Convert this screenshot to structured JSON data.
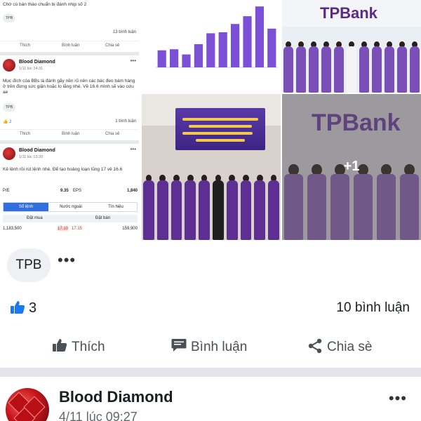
{
  "media": {
    "screenshot": {
      "post_top": {
        "text": "Chờ cú bán tháo chuẩn bị đánh nhịp số 2",
        "tag": "TPB",
        "comments": "13 bình luận",
        "actions": [
          "Thích",
          "Bình luận",
          "Chia sẻ"
        ]
      },
      "post_mid": {
        "author": "Blood Diamond",
        "time": "1/11 lúc 14:31",
        "text": "Mục đích của BBs là đánh gãy nền rũ nên các bác đeo bám hàng ở trên đừng sức giận hoặc lo lắng nhé. Về 16.6 mình sẽ vào cứu ae",
        "tag": "TPB",
        "likes": "2",
        "comments": "1 bình luận",
        "actions": [
          "Thích",
          "Bình luận",
          "Chia sẻ"
        ]
      },
      "post_low": {
        "author": "Blood Diamond",
        "time": "1/11 lúc 13:20",
        "text": "Kê lệnh rồi rút lệnh nhé. Để tạo hoảng loạn lũng 17 về 16.6"
      },
      "stock_panel": {
        "pe_label": "P/E",
        "pe_value": "9.35",
        "eps_label": "EPS",
        "eps_value": "1,840",
        "tabs": [
          "Sổ lệnh",
          "Nước ngoài",
          "Tín hiệu"
        ],
        "buy_header": "Đặt mua",
        "sell_header": "Đặt bán",
        "row": {
          "buy_vol": "1,183,500",
          "buy_price": "17.10",
          "sell_price": "17.15",
          "sell_vol": "159,900"
        }
      }
    },
    "photo_brand": "TPBank",
    "more_photos": "+1"
  },
  "chart_data": {
    "type": "bar",
    "values": [
      33,
      35,
      25,
      45,
      66,
      68,
      84,
      99,
      118,
      75
    ],
    "color": "#7b4fd6"
  },
  "post_footer": {
    "tag": "TPB",
    "more": "•••",
    "reaction_count": "3",
    "comment_count": "10 bình luận",
    "like_label": "Thích",
    "comment_label": "Bình luận",
    "share_label": "Chia sè"
  },
  "next_post": {
    "author": "Blood Diamond",
    "time": "4/11 lúc 09:27",
    "more": "•••"
  },
  "colors": {
    "accent_blue": "#1877f2",
    "tpbank_purple": "#5b2a86",
    "divider": "#e4e5e8"
  }
}
